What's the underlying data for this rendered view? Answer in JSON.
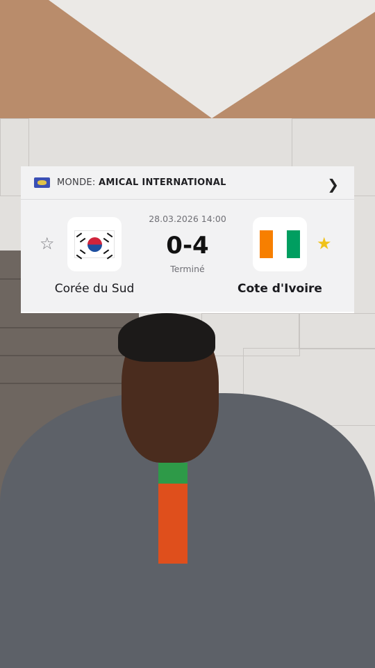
{
  "match_card": {
    "competition": {
      "country": "MONDE:",
      "league": "AMICAL INTERNATIONAL",
      "flag_icon": "world-flag-icon"
    },
    "datetime": "28.03.2026 14:00",
    "score": "0-4",
    "status": "Terminé",
    "home": {
      "name": "Corée du Sud",
      "favorite": false,
      "flag_icon": "south-korea-flag-icon"
    },
    "away": {
      "name": "Cote d'Ivoire",
      "favorite": true,
      "flag_icon": "ivory-coast-flag-icon",
      "flag_colors": [
        "#f77f00",
        "#ffffff",
        "#009e60"
      ]
    }
  },
  "colors": {
    "card_background": "#f2f2f3",
    "favorite_star": "#f0c21a",
    "inactive_star": "#7b7b80"
  }
}
